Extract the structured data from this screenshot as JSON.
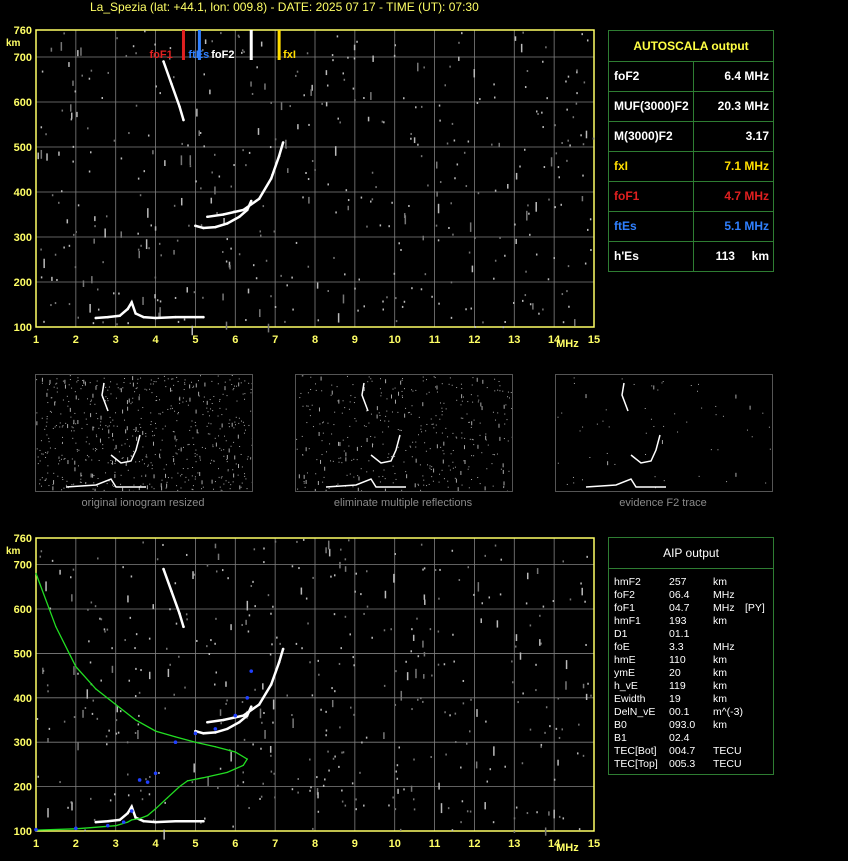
{
  "header": {
    "title": "La_Spezia (lat: +44.1, lon: 009.8) - DATE: 2025 07 17 - TIME (UT): 07:30"
  },
  "colors": {
    "axis": "#ffff66",
    "grid": "#808080",
    "trace": "#ffffff",
    "foF1": "#e02020",
    "ftEs": "#3080ff",
    "fxI": "#ffdd00",
    "foF2": "#ffffff",
    "profile": "#22dd22",
    "aip_points": "#2040ff"
  },
  "ionogram_top": {
    "y_unit": "km",
    "x_unit": "MHz",
    "markers": [
      {
        "label": "foF1",
        "freq": 4.7,
        "color": "#e02020"
      },
      {
        "label": "ftEs",
        "freq": 5.1,
        "color": "#3080ff"
      },
      {
        "label": "foF2",
        "freq": 6.4,
        "color": "#ffffff"
      },
      {
        "label": "fxI",
        "freq": 7.1,
        "color": "#ffdd00"
      }
    ]
  },
  "ionogram_bottom": {
    "y_unit": "km",
    "x_unit": "MHz"
  },
  "autoscala": {
    "title": "AUTOSCALA output",
    "rows": [
      {
        "label": "foF2",
        "value": "6.4 MHz",
        "color": "#ffffff"
      },
      {
        "label": "MUF(3000)F2",
        "value": "20.3 MHz",
        "color": "#ffffff"
      },
      {
        "label": "M(3000)F2",
        "value": "3.17",
        "color": "#ffffff"
      },
      {
        "label": "fxI",
        "value": "7.1 MHz",
        "color": "#ffdd00"
      },
      {
        "label": "foF1",
        "value": "4.7 MHz",
        "color": "#e02020"
      },
      {
        "label": "ftEs",
        "value": "5.1 MHz",
        "color": "#3080ff"
      },
      {
        "label": "h'Es",
        "value": "113     km",
        "color": "#ffffff"
      }
    ]
  },
  "thumbnails": [
    {
      "caption": "original ionogram resized"
    },
    {
      "caption": "eliminate multiple reflections"
    },
    {
      "caption": "evidence F2 trace"
    }
  ],
  "aip": {
    "title": "AIP output",
    "rows": [
      {
        "name": "hmF2",
        "value": "257",
        "unit": "km",
        "extra": ""
      },
      {
        "name": "foF2",
        "value": "06.4",
        "unit": "MHz",
        "extra": ""
      },
      {
        "name": "foF1",
        "value": "04.7",
        "unit": "MHz",
        "extra": "[PY]"
      },
      {
        "name": "hmF1",
        "value": "193",
        "unit": "km",
        "extra": ""
      },
      {
        "name": "D1",
        "value": "01.1",
        "unit": "",
        "extra": ""
      },
      {
        "name": "foE",
        "value": "3.3",
        "unit": "MHz",
        "extra": ""
      },
      {
        "name": "hmE",
        "value": "110",
        "unit": "km",
        "extra": ""
      },
      {
        "name": "ymE",
        "value": "20",
        "unit": "km",
        "extra": ""
      },
      {
        "name": "h_vE",
        "value": "119",
        "unit": "km",
        "extra": ""
      },
      {
        "name": "Ewidth",
        "value": "19",
        "unit": "km",
        "extra": ""
      },
      {
        "name": "DelN_vE",
        "value": "00.1",
        "unit": "m^(-3)",
        "extra": ""
      },
      {
        "name": "B0",
        "value": "093.0",
        "unit": "km",
        "extra": ""
      },
      {
        "name": "B1",
        "value": "02.4",
        "unit": "",
        "extra": ""
      },
      {
        "name": "TEC[Bot]",
        "value": "004.7",
        "unit": "TECU",
        "extra": ""
      },
      {
        "name": "TEC[Top]",
        "value": "005.3",
        "unit": "TECU",
        "extra": ""
      }
    ]
  },
  "chart_data": [
    {
      "type": "scatter",
      "xlim": [
        1,
        15
      ],
      "ylim": [
        100,
        760
      ],
      "x_ticks": [
        1,
        2,
        3,
        4,
        5,
        6,
        7,
        8,
        9,
        10,
        11,
        12,
        13,
        14,
        15
      ],
      "y_ticks": [
        100,
        200,
        300,
        400,
        500,
        600,
        700,
        760
      ],
      "grid": true,
      "series": [
        {
          "values": [
            [
              2.5,
              120
            ],
            [
              2.8,
              122
            ],
            [
              3.1,
              125
            ],
            [
              3.3,
              140
            ],
            [
              3.4,
              155
            ],
            [
              3.5,
              130
            ],
            [
              3.7,
              122
            ],
            [
              4.0,
              120
            ],
            [
              4.5,
              122
            ],
            [
              5.0,
              122
            ],
            [
              5.2,
              122
            ]
          ]
        },
        {
          "values": [
            [
              5.0,
              325
            ],
            [
              5.2,
              320
            ],
            [
              5.5,
              322
            ],
            [
              5.8,
              330
            ],
            [
              6.1,
              345
            ],
            [
              6.3,
              360
            ],
            [
              6.4,
              380
            ]
          ]
        },
        {
          "values": [
            [
              5.3,
              345
            ],
            [
              5.7,
              350
            ],
            [
              6.2,
              360
            ],
            [
              6.6,
              385
            ],
            [
              6.9,
              430
            ],
            [
              7.1,
              480
            ],
            [
              7.2,
              510
            ]
          ]
        },
        {
          "values": [
            [
              4.2,
              690
            ],
            [
              4.4,
              640
            ],
            [
              4.6,
              590
            ],
            [
              4.7,
              560
            ]
          ]
        }
      ]
    },
    {
      "type": "scatter",
      "xlim": [
        1,
        15
      ],
      "ylim": [
        100,
        760
      ],
      "x_ticks": [
        1,
        2,
        3,
        4,
        5,
        6,
        7,
        8,
        9,
        10,
        11,
        12,
        13,
        14,
        15
      ],
      "y_ticks": [
        100,
        200,
        300,
        400,
        500,
        600,
        700,
        760
      ],
      "grid": true,
      "series": [
        {
          "values": [
            [
              1.0,
              680
            ],
            [
              1.5,
              560
            ],
            [
              2.0,
              470
            ],
            [
              2.5,
              420
            ],
            [
              3.0,
              385
            ],
            [
              3.5,
              350
            ],
            [
              4.0,
              325
            ],
            [
              4.5,
              312
            ],
            [
              5.0,
              300
            ],
            [
              5.5,
              290
            ],
            [
              6.0,
              278
            ],
            [
              6.3,
              262
            ],
            [
              6.2,
              248
            ],
            [
              5.8,
              232
            ],
            [
              5.2,
              220
            ],
            [
              4.8,
              213
            ],
            [
              4.6,
              200
            ],
            [
              4.3,
              175
            ],
            [
              4.0,
              150
            ],
            [
              3.8,
              135
            ],
            [
              3.6,
              128
            ],
            [
              3.4,
              125
            ],
            [
              3.3,
              120
            ],
            [
              3.0,
              112
            ],
            [
              2.0,
              105
            ],
            [
              1.0,
              102
            ]
          ]
        },
        {
          "values": [
            [
              1.0,
              103
            ],
            [
              2.0,
              106
            ],
            [
              2.8,
              112
            ],
            [
              3.2,
              120
            ],
            [
              3.4,
              145
            ],
            [
              3.6,
              215
            ],
            [
              3.8,
              210
            ],
            [
              4.0,
              230
            ],
            [
              4.5,
              300
            ],
            [
              5.0,
              320
            ],
            [
              5.5,
              330
            ],
            [
              6.0,
              360
            ],
            [
              6.3,
              400
            ],
            [
              6.4,
              460
            ]
          ]
        }
      ]
    }
  ]
}
